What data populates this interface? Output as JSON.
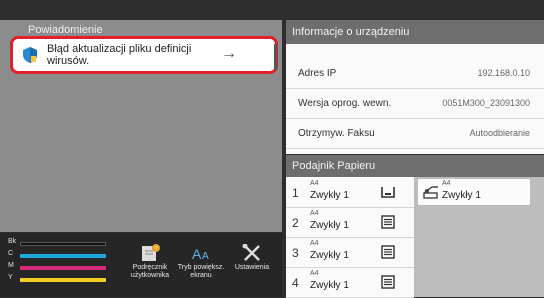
{
  "notifications": {
    "header": "Powiadomienie",
    "item_text": "Błąd aktualizacji pliku definicji wirusów.",
    "arrow": "→"
  },
  "device_info": {
    "title": "Informacje o urządzeniu",
    "rows": [
      {
        "label": "Adres IP",
        "value": "192.168.0.10"
      },
      {
        "label": "Wersja oprog. wewn.",
        "value": "0051M300_23091300"
      },
      {
        "label": "Otrzymyw. Faksu",
        "value": "Autoodbieranie"
      }
    ]
  },
  "paper_tray": {
    "title": "Podajnik Papieru",
    "trays": [
      {
        "num": "1",
        "size": "A4",
        "type": "Zwykły 1"
      },
      {
        "num": "2",
        "size": "A4",
        "type": "Zwykły 1"
      },
      {
        "num": "3",
        "size": "A4",
        "type": "Zwykły 1"
      },
      {
        "num": "4",
        "size": "A4",
        "type": "Zwykły 1"
      }
    ],
    "bypass": {
      "size": "A4",
      "type": "Zwykły 1"
    }
  },
  "toner": [
    {
      "letter": "Bk",
      "color": "#111111",
      "level": 1.0
    },
    {
      "letter": "C",
      "color": "#1ea7d8",
      "level": 1.0
    },
    {
      "letter": "M",
      "color": "#d82a7a",
      "level": 1.0
    },
    {
      "letter": "Y",
      "color": "#f0d020",
      "level": 1.0
    }
  ],
  "shortcuts": [
    {
      "label": "Podręcznik użytkownika",
      "icon": "manual-icon"
    },
    {
      "label": "Tryb powiększ. ekranu",
      "icon": "text-enlarge-icon"
    },
    {
      "label": "Ustawienia",
      "icon": "settings-tools-icon"
    }
  ],
  "colors": {
    "alert_border": "#e0202a",
    "shield": "#2a8ad4"
  }
}
